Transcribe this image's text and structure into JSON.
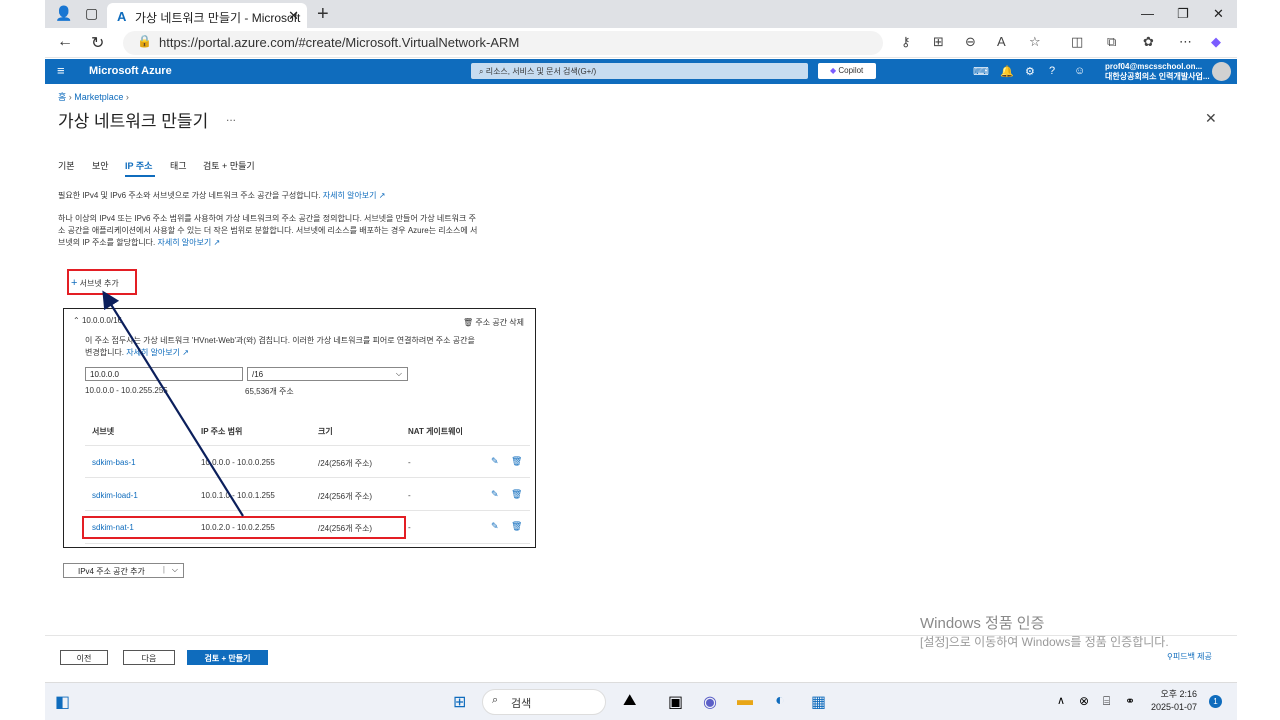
{
  "browser": {
    "tab_title": "가상 네트워크 만들기 - Microsoft",
    "url": "https://portal.azure.com/#create/Microsoft.VirtualNetwork-ARM"
  },
  "azure_header": {
    "brand": "Microsoft Azure",
    "search_placeholder": "리소스, 서비스 및 문서 검색(G+/)",
    "copilot_label": "Copilot",
    "user_email": "prof04@mscsschool.on...",
    "user_org": "대한상공회의소 인력개발사업..."
  },
  "breadcrumb": {
    "home": "홈",
    "marketplace": "Marketplace"
  },
  "page": {
    "title": "가상 네트워크 만들기",
    "more": "..."
  },
  "tabs": [
    "기본",
    "보안",
    "IP 주소",
    "태그",
    "검토 + 만들기"
  ],
  "descriptions": {
    "line1": "필요한 IPv4 및 IPv6 주소와 서브넷으로 가상 네트워크 주소 공간을 구성합니다.",
    "learn_more": "자세히 알아보기",
    "para2_line1": "하나 이상의 IPv4 또는 IPv6 주소 범위를 사용하여 가상 네트워크의 주소 공간을 정의합니다. 서브넷을 만들어 가상 네트워크 주",
    "para2_line2": "소 공간을 애플리케이션에서 사용할 수 있는 더 작은 범위로 분할합니다. 서브넷에 리소스를 배포하는 경우 Azure는 리소스에 서",
    "para2_line3": "브넷의 IP 주소를 할당합니다.",
    "learn_more2": "자세히 알아보기"
  },
  "add_subnet": "서브넷 추가",
  "address_space": {
    "header": "10.0.0.0/16",
    "delete_label": "주소 공간 삭제",
    "warning_line1": "이 주소 접두사는 가상 네트워크 'HVnet-Web'과(와) 겹칩니다. 이러한 가상 네트워크를 피어로 연결하려면 주소 공간을",
    "warning_line2": "변경합니다.",
    "warning_link": "자세히 알아보기",
    "ip_value": "10.0.0.0",
    "prefix_value": "/16",
    "range_text": "10.0.0.0 - 10.0.255.255",
    "count_text": "65,536개 주소"
  },
  "subnet_table": {
    "headers": [
      "서브넷",
      "IP 주소 범위",
      "크기",
      "NAT 게이트웨이"
    ],
    "rows": [
      {
        "name": "sdkim-bas-1",
        "range": "10.0.0.0 - 10.0.0.255",
        "size": "/24(256개 주소)",
        "nat": "-"
      },
      {
        "name": "sdkim-load-1",
        "range": "10.0.1.0 - 10.0.1.255",
        "size": "/24(256개 주소)",
        "nat": "-"
      },
      {
        "name": "sdkim-nat-1",
        "range": "10.0.2.0 - 10.0.2.255",
        "size": "/24(256개 주소)",
        "nat": "-"
      }
    ]
  },
  "ipv4_add": "IPv4 주소 공간 추가",
  "footer": {
    "prev": "이전",
    "next": "다음",
    "review": "검토 + 만들기",
    "feedback": "피드백 제공"
  },
  "watermark": {
    "line1": "Windows 정품 인증",
    "line2": "[설정]으로 이동하여 Windows를 정품 인증합니다."
  },
  "taskbar": {
    "search": "검색",
    "time": "오후 2:16",
    "date": "2025-01-07",
    "notif_count": "1"
  },
  "colors": {
    "azure_blue": "#0f6cbd",
    "annotation_red": "#e31e24",
    "arrow_navy": "#0b1f5c"
  }
}
